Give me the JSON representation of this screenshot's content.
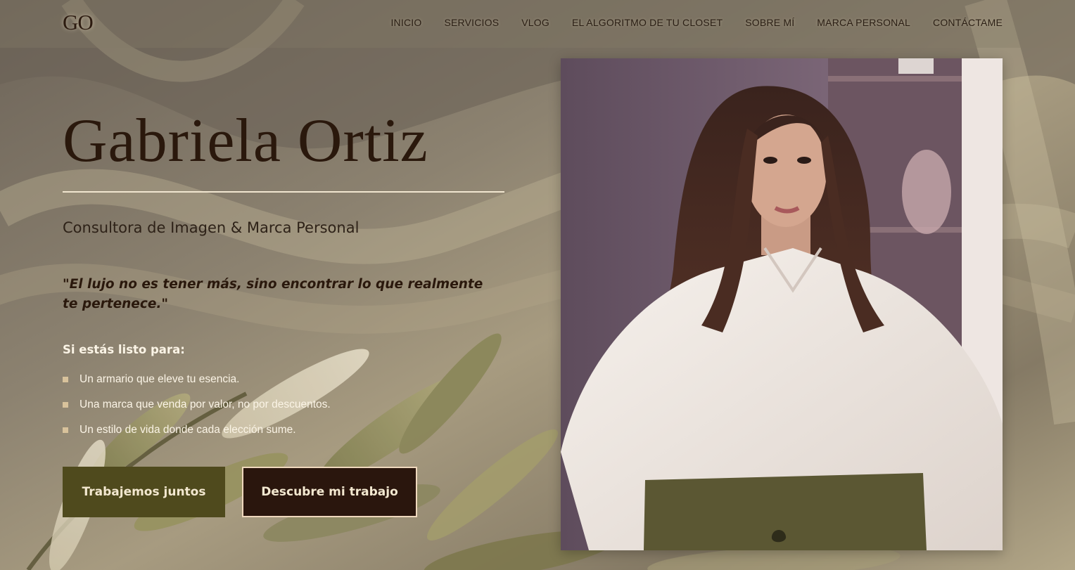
{
  "header": {
    "logo": "GO",
    "nav": [
      "INICIO",
      "SERVICIOS",
      "VLOG",
      "EL ALGORITMO DE TU CLOSET",
      "SOBRE MÍ",
      "MARCA PERSONAL",
      "CONTÁCTAME"
    ]
  },
  "hero": {
    "name": "Gabriela Ortiz",
    "subtitle": "Consultora de Imagen & Marca Personal",
    "quote": "\"El lujo no es tener más, sino encontrar lo que realmente te pertenece.\"",
    "list_heading": "Si estás listo para:",
    "bullets": [
      "Un armario que eleve tu esencia.",
      "Una marca que venda por valor, no por descuentos.",
      "Un estilo de vida donde cada elección sume."
    ],
    "primary_button": "Trabajemos juntos",
    "secondary_button": "Descubre mi trabajo"
  },
  "colors": {
    "name_text": "#2a180c",
    "primary_button_bg": "#4f4a1d",
    "secondary_button_bg": "#2a160d",
    "secondary_button_border": "#efd8bd",
    "divider": "#f1e6d0",
    "light_text": "#fbf4e6"
  }
}
